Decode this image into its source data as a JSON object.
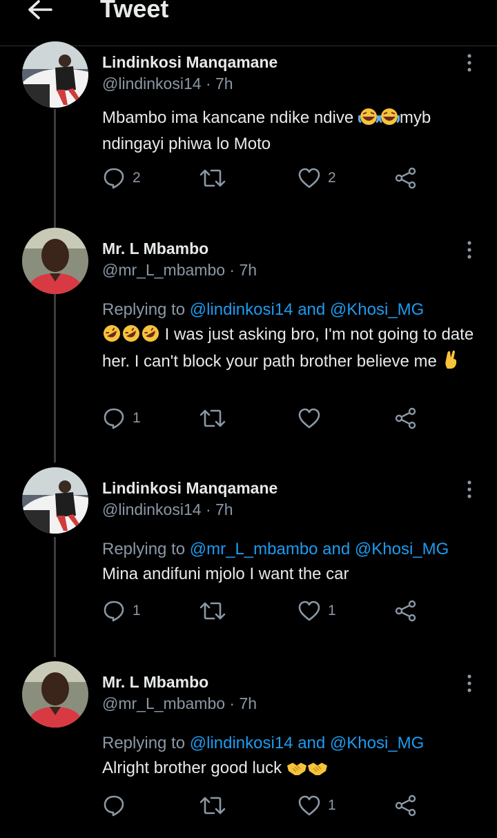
{
  "header": {
    "title": "Tweet"
  },
  "tweets": [
    {
      "name": "Lindinkosi Manqamane",
      "handle": "@lindinkosi14",
      "time": "· 7h",
      "replying_prefix": "",
      "replying_mentions": "",
      "text": "Mbambo ima kancane ndike ndive",
      "text_after_emoji": "myb ndingayi phiwa lo Moto",
      "emojis": [
        "face-with-tears-of-joy",
        "face-with-tears-of-joy"
      ],
      "reply_count": "2",
      "retweet_count": "",
      "like_count": "2"
    },
    {
      "name": "Mr. L Mbambo",
      "handle": "@mr_L_mbambo",
      "time": "· 7h",
      "replying_prefix": "Replying to",
      "replying_mentions": "@lindinkosi14 and @Khosi_MG",
      "text": "I was just asking bro, I'm not going to date her. I can't block your path brother believe me",
      "emojis": [
        "rolling-on-floor-laughing",
        "rolling-on-floor-laughing",
        "rolling-on-floor-laughing",
        "crossed-fingers"
      ],
      "reply_count": "1",
      "retweet_count": "",
      "like_count": ""
    },
    {
      "name": "Lindinkosi Manqamane",
      "handle": "@lindinkosi14",
      "time": "· 7h",
      "replying_prefix": "Replying to",
      "replying_mentions": "@mr_L_mbambo and @Khosi_MG",
      "text": "Mina andifuni mjolo I want the car",
      "emojis": [],
      "reply_count": "1",
      "retweet_count": "",
      "like_count": "1"
    },
    {
      "name": "Mr. L Mbambo",
      "handle": "@mr_L_mbambo",
      "time": "· 7h",
      "replying_prefix": "Replying to",
      "replying_mentions": "@lindinkosi14 and @Khosi_MG",
      "text": "Alright brother good luck",
      "emojis": [
        "handshake",
        "handshake"
      ],
      "reply_count": "",
      "retweet_count": "",
      "like_count": "1"
    }
  ],
  "colors": {
    "background": "#000000",
    "text": "#e7e9ea",
    "secondary": "#8b98a5",
    "link": "#1d9bf0",
    "divider": "#2f3336"
  }
}
